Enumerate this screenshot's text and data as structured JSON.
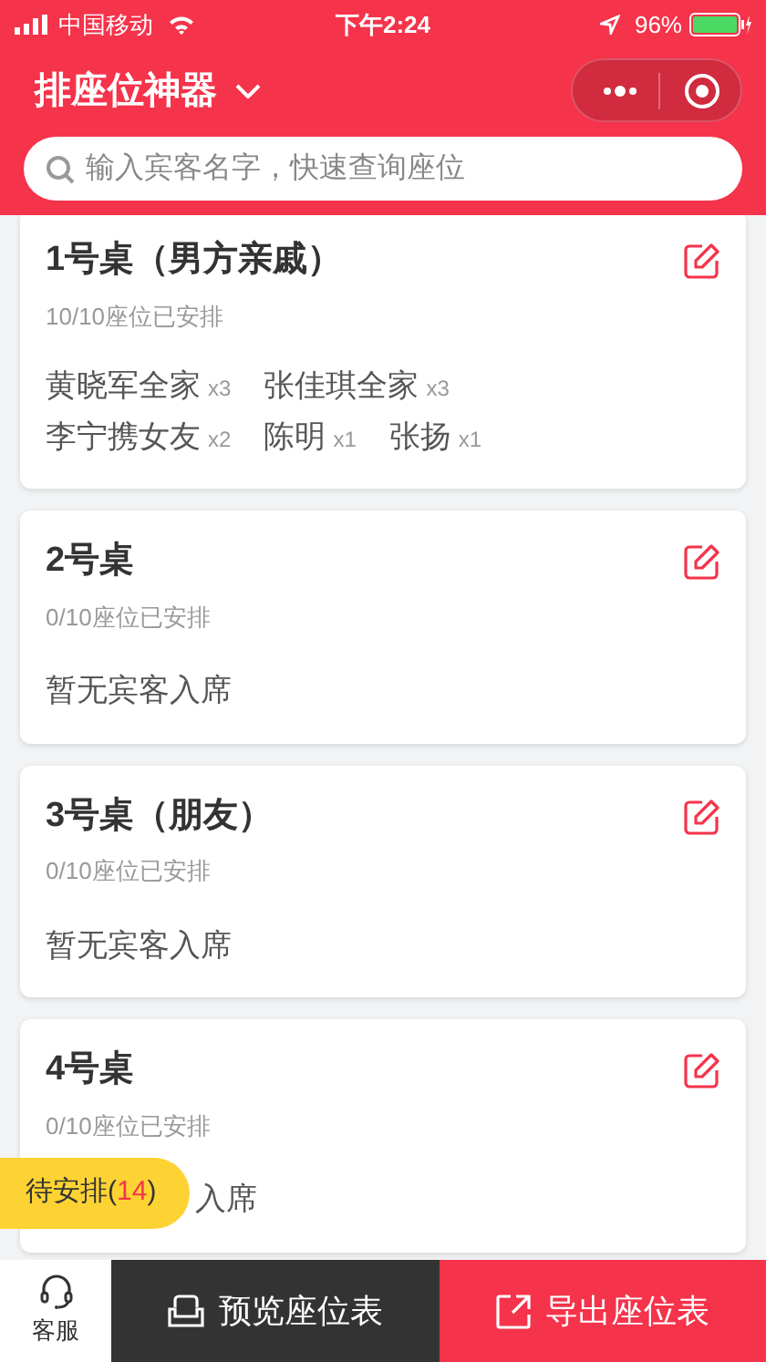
{
  "status_bar": {
    "carrier": "中国移动",
    "time": "下午2:24",
    "battery": "96%"
  },
  "header": {
    "title": "排座位神器"
  },
  "search": {
    "placeholder": "输入宾客名字，快速查询座位"
  },
  "tables": [
    {
      "title": "1号桌（男方亲戚）",
      "seats_text": "10/10座位已安排",
      "guests": [
        {
          "name": "黄晓军全家",
          "count": "x3"
        },
        {
          "name": "张佳琪全家",
          "count": "x3"
        },
        {
          "name": "李宁携女友",
          "count": "x2"
        },
        {
          "name": "陈明",
          "count": "x1"
        },
        {
          "name": "张扬",
          "count": "x1"
        }
      ]
    },
    {
      "title": "2号桌",
      "seats_text": "0/10座位已安排",
      "empty_text": "暂无宾客入席"
    },
    {
      "title": "3号桌（朋友）",
      "seats_text": "0/10座位已安排",
      "empty_text": "暂无宾客入席"
    },
    {
      "title": "4号桌",
      "seats_text": "0/10座位已安排",
      "empty_text": "入席"
    }
  ],
  "pending_badge": {
    "prefix": "待安排(",
    "count": "14",
    "suffix": ")"
  },
  "bottom_bar": {
    "service": "客服",
    "preview": "预览座位表",
    "export": "导出座位表"
  }
}
